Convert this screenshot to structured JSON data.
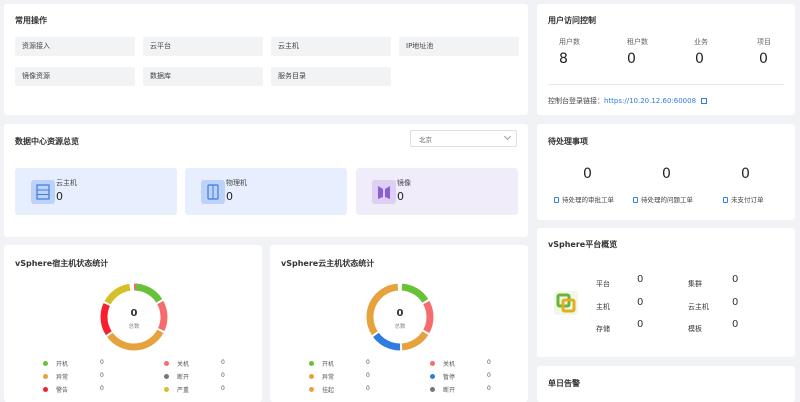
{
  "common_ops": {
    "title": "常用操作",
    "buttons": [
      "资源接入",
      "云平台",
      "云主机",
      "IP地址池",
      "镜像资源",
      "数据库",
      "服务目录"
    ]
  },
  "access": {
    "title": "用户访问控制",
    "stats": [
      {
        "label": "用户数",
        "value": "8"
      },
      {
        "label": "租户数",
        "value": "0"
      },
      {
        "label": "业务",
        "value": "0"
      },
      {
        "label": "项目",
        "value": "0"
      }
    ],
    "link_label": "控制台登录链接：",
    "link_url": "https://10.20.12.60:60008"
  },
  "dc": {
    "title": "数据中心资源总览",
    "region": "北京",
    "items": [
      {
        "label": "云主机",
        "value": "0",
        "icon": "server-icon",
        "color": "#e7efff"
      },
      {
        "label": "物理机",
        "value": "0",
        "icon": "physical-machine-icon",
        "color": "#e7efff"
      },
      {
        "label": "镜像",
        "value": "0",
        "icon": "image-icon",
        "color": "#f1ecfa"
      }
    ]
  },
  "pending": {
    "title": "待处理事项",
    "items": [
      {
        "value": "0",
        "label": "待处理的审批工单"
      },
      {
        "value": "0",
        "label": "待处理的问题工单"
      },
      {
        "value": "0",
        "label": "未支付订单"
      }
    ]
  },
  "host_stats": {
    "title": "vSphere宿主机状态统计",
    "center_value": "0",
    "center_label": "总数",
    "legend": [
      {
        "label": "开机",
        "value": "0",
        "color": "#67c23a"
      },
      {
        "label": "关机",
        "value": "0",
        "color": "#f56c6c"
      },
      {
        "label": "异常",
        "value": "0",
        "color": "#e6a23c"
      },
      {
        "label": "断开",
        "value": "0",
        "color": "#777777"
      },
      {
        "label": "警告",
        "value": "0",
        "color": "#f5222d"
      },
      {
        "label": "严重",
        "value": "0",
        "color": "#d4c02a"
      }
    ]
  },
  "vm_stats": {
    "title": "vSphere云主机状态统计",
    "center_value": "0",
    "center_label": "总数",
    "legend": [
      {
        "label": "开机",
        "value": "0",
        "color": "#67c23a"
      },
      {
        "label": "关机",
        "value": "0",
        "color": "#f56c6c"
      },
      {
        "label": "异常",
        "value": "0",
        "color": "#e6a23c"
      },
      {
        "label": "暂停",
        "value": "0",
        "color": "#2f7ce0"
      },
      {
        "label": "挂起",
        "value": "0",
        "color": "#e6a23c"
      },
      {
        "label": "断开",
        "value": "0",
        "color": "#777777"
      }
    ]
  },
  "platform": {
    "title": "vSphere平台概览",
    "stats": [
      {
        "label": "平台",
        "value": "0"
      },
      {
        "label": "集群",
        "value": "0"
      },
      {
        "label": "主机",
        "value": "0"
      },
      {
        "label": "云主机",
        "value": "0"
      },
      {
        "label": "存储",
        "value": "0"
      },
      {
        "label": "模板",
        "value": "0"
      }
    ]
  },
  "alarms": {
    "title": "单日告警"
  }
}
